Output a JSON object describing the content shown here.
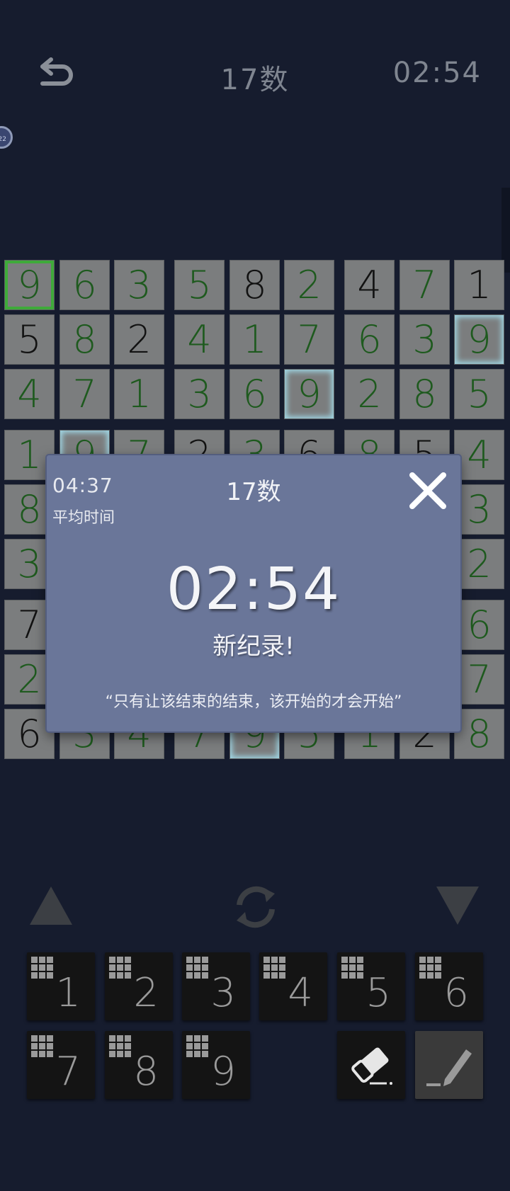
{
  "header": {
    "title": "17数",
    "timer": "02:54",
    "badge": "22"
  },
  "board": {
    "rows": [
      [
        "9",
        "6",
        "3",
        "5",
        "8",
        "2",
        "4",
        "7",
        "1"
      ],
      [
        "5",
        "8",
        "2",
        "4",
        "1",
        "7",
        "6",
        "3",
        "9"
      ],
      [
        "4",
        "7",
        "1",
        "3",
        "6",
        "9",
        "2",
        "8",
        "5"
      ],
      [
        "1",
        "9",
        "7",
        "2",
        "3",
        "6",
        "8",
        "5",
        "4"
      ],
      [
        "8",
        "",
        "",
        "",
        "",
        "",
        "",
        "",
        "3"
      ],
      [
        "3",
        "",
        "",
        "",
        "",
        "",
        "",
        "",
        "2"
      ],
      [
        "7",
        "",
        "",
        "",
        "",
        "",
        "",
        "",
        "6"
      ],
      [
        "2",
        "",
        "",
        "",
        "",
        "",
        "",
        "",
        "7"
      ],
      [
        "6",
        "3",
        "4",
        "7",
        "9",
        "5",
        "1",
        "2",
        "8"
      ]
    ],
    "given": [
      [
        0,
        0,
        0,
        0,
        1,
        0,
        1,
        0,
        1
      ],
      [
        1,
        0,
        1,
        0,
        0,
        0,
        0,
        0,
        0
      ],
      [
        0,
        0,
        0,
        0,
        0,
        0,
        0,
        0,
        0
      ],
      [
        0,
        0,
        0,
        1,
        0,
        1,
        0,
        1,
        0
      ],
      [
        0,
        0,
        0,
        0,
        0,
        0,
        0,
        0,
        0
      ],
      [
        0,
        0,
        0,
        0,
        0,
        0,
        0,
        0,
        0
      ],
      [
        1,
        0,
        0,
        0,
        0,
        0,
        0,
        0,
        0
      ],
      [
        0,
        0,
        0,
        0,
        0,
        0,
        0,
        0,
        0
      ],
      [
        1,
        0,
        0,
        0,
        0,
        0,
        0,
        1,
        0
      ]
    ]
  },
  "modal": {
    "avg_time": "04:37",
    "avg_label": "平均时间",
    "title": "17数",
    "time": "02:54",
    "record": "新纪录!",
    "quote": "“只有让该结束的结束，该开始的才会开始”"
  },
  "keypad": {
    "digits": [
      "1",
      "2",
      "3",
      "4",
      "5",
      "6",
      "7",
      "8",
      "9"
    ]
  },
  "icons": [
    "back-icon",
    "close-icon",
    "arrow-up-icon",
    "rotate-icon",
    "arrow-down-icon",
    "eraser-icon",
    "pencil-icon",
    "notes-grid-icon"
  ]
}
